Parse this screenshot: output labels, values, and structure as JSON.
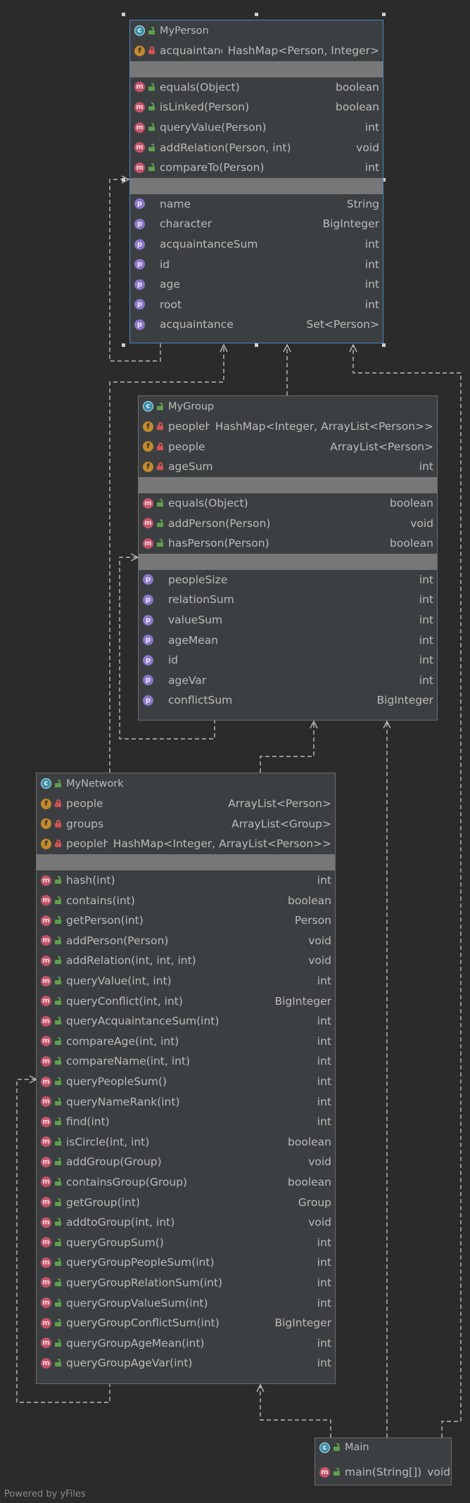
{
  "classes": {
    "myperson": {
      "name": "MyPerson",
      "fields": [
        {
          "vis": "pri",
          "name": "acquaintance",
          "type": "HashMap<Person, Integer>"
        }
      ],
      "methods": [
        {
          "vis": "pub",
          "name": "equals(Object)",
          "type": "boolean"
        },
        {
          "vis": "pub",
          "name": "isLinked(Person)",
          "type": "boolean"
        },
        {
          "vis": "pub",
          "name": "queryValue(Person)",
          "type": "int"
        },
        {
          "vis": "pub",
          "name": "addRelation(Person, int)",
          "type": "void"
        },
        {
          "vis": "pub",
          "name": "compareTo(Person)",
          "type": "int"
        }
      ],
      "properties": [
        {
          "name": "name",
          "type": "String"
        },
        {
          "name": "character",
          "type": "BigInteger"
        },
        {
          "name": "acquaintanceSum",
          "type": "int"
        },
        {
          "name": "id",
          "type": "int"
        },
        {
          "name": "age",
          "type": "int"
        },
        {
          "name": "root",
          "type": "int"
        },
        {
          "name": "acquaintance",
          "type": "Set<Person>"
        }
      ]
    },
    "mygroup": {
      "name": "MyGroup",
      "fields": [
        {
          "vis": "pri",
          "name": "peoplehm",
          "type": "HashMap<Integer, ArrayList<Person>>"
        },
        {
          "vis": "pri",
          "name": "people",
          "type": "ArrayList<Person>"
        },
        {
          "vis": "pri",
          "name": "ageSum",
          "type": "int"
        }
      ],
      "methods": [
        {
          "vis": "pub",
          "name": "equals(Object)",
          "type": "boolean"
        },
        {
          "vis": "pub",
          "name": "addPerson(Person)",
          "type": "void"
        },
        {
          "vis": "pub",
          "name": "hasPerson(Person)",
          "type": "boolean"
        }
      ],
      "properties": [
        {
          "name": "peopleSize",
          "type": "int"
        },
        {
          "name": "relationSum",
          "type": "int"
        },
        {
          "name": "valueSum",
          "type": "int"
        },
        {
          "name": "ageMean",
          "type": "int"
        },
        {
          "name": "id",
          "type": "int"
        },
        {
          "name": "ageVar",
          "type": "int"
        },
        {
          "name": "conflictSum",
          "type": "BigInteger"
        }
      ]
    },
    "mynetwork": {
      "name": "MyNetwork",
      "fields": [
        {
          "vis": "pri",
          "name": "people",
          "type": "ArrayList<Person>"
        },
        {
          "vis": "pri",
          "name": "groups",
          "type": "ArrayList<Group>"
        },
        {
          "vis": "pri",
          "name": "peoplehm",
          "type": "HashMap<Integer, ArrayList<Person>>"
        }
      ],
      "methods": [
        {
          "vis": "pub",
          "name": "hash(int)",
          "type": "int"
        },
        {
          "vis": "pub",
          "name": "contains(int)",
          "type": "boolean"
        },
        {
          "vis": "pub",
          "name": "getPerson(int)",
          "type": "Person"
        },
        {
          "vis": "pub",
          "name": "addPerson(Person)",
          "type": "void"
        },
        {
          "vis": "pub",
          "name": "addRelation(int, int, int)",
          "type": "void"
        },
        {
          "vis": "pub",
          "name": "queryValue(int, int)",
          "type": "int"
        },
        {
          "vis": "pub",
          "name": "queryConflict(int, int)",
          "type": "BigInteger"
        },
        {
          "vis": "pub",
          "name": "queryAcquaintanceSum(int)",
          "type": "int"
        },
        {
          "vis": "pub",
          "name": "compareAge(int, int)",
          "type": "int"
        },
        {
          "vis": "pub",
          "name": "compareName(int, int)",
          "type": "int"
        },
        {
          "vis": "pub",
          "name": "queryPeopleSum()",
          "type": "int"
        },
        {
          "vis": "pub",
          "name": "queryNameRank(int)",
          "type": "int"
        },
        {
          "vis": "pub",
          "name": "find(int)",
          "type": "int"
        },
        {
          "vis": "pub",
          "name": "isCircle(int, int)",
          "type": "boolean"
        },
        {
          "vis": "pub",
          "name": "addGroup(Group)",
          "type": "void"
        },
        {
          "vis": "pub",
          "name": "containsGroup(Group)",
          "type": "boolean"
        },
        {
          "vis": "pub",
          "name": "getGroup(int)",
          "type": "Group"
        },
        {
          "vis": "pub",
          "name": "addtoGroup(int, int)",
          "type": "void"
        },
        {
          "vis": "pub",
          "name": "queryGroupSum()",
          "type": "int"
        },
        {
          "vis": "pub",
          "name": "queryGroupPeopleSum(int)",
          "type": "int"
        },
        {
          "vis": "pub",
          "name": "queryGroupRelationSum(int)",
          "type": "int"
        },
        {
          "vis": "pub",
          "name": "queryGroupValueSum(int)",
          "type": "int"
        },
        {
          "vis": "pub",
          "name": "queryGroupConflictSum(int)",
          "type": "BigInteger"
        },
        {
          "vis": "pub",
          "name": "queryGroupAgeMean(int)",
          "type": "int"
        },
        {
          "vis": "pub",
          "name": "queryGroupAgeVar(int)",
          "type": "int"
        }
      ],
      "properties": []
    },
    "main": {
      "name": "Main",
      "fields": [],
      "methods": [
        {
          "vis": "pub",
          "name": "main(String[])",
          "type": "void"
        }
      ],
      "properties": []
    }
  },
  "footer": "Powered by yFiles",
  "colors": {
    "background": "#2b2b2b",
    "class_fill": "#3c3f41",
    "separator": "#777777",
    "selection_border": "#4a88c7",
    "edge": "#bbbbbb"
  }
}
